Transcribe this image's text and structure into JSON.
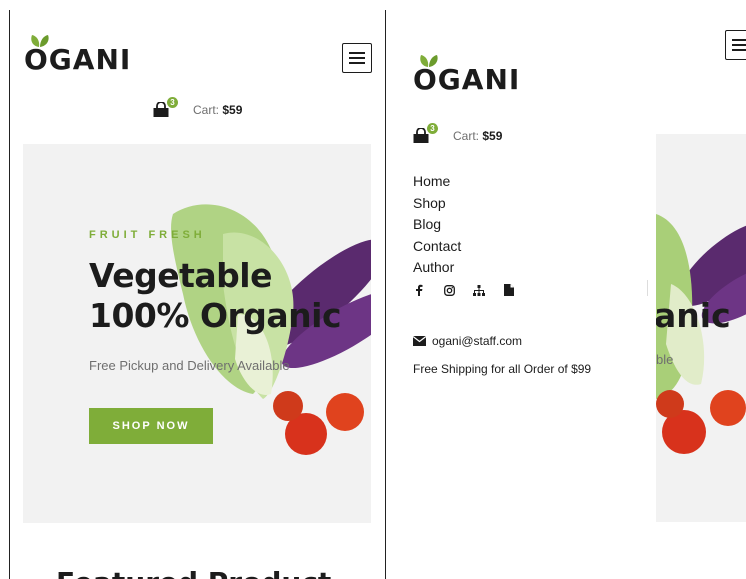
{
  "brand": {
    "name": "OGANI"
  },
  "cart": {
    "count": "3",
    "label": "Cart:",
    "total": "$59"
  },
  "hero": {
    "tag": "FRUIT FRESH",
    "title_line1": "Vegetable",
    "title_line2": "100% Organic",
    "subtitle": "Free Pickup and Delivery Available",
    "button": "SHOP NOW"
  },
  "section_cut": "Featured Product",
  "menu": {
    "items": [
      "Home",
      "Shop",
      "Blog",
      "Contact",
      "Author"
    ],
    "social": [
      "facebook-icon",
      "instagram-icon",
      "sitemap-icon",
      "file-icon"
    ],
    "email": "ogani@staff.com",
    "shipping": "Free Shipping for all Order of $99"
  },
  "overlay_fragments": {
    "title": "anic",
    "subtitle": "ble"
  },
  "colors": {
    "accent": "#7fad39",
    "hero_bg": "#f2f2f2",
    "text": "#1c1c1c"
  }
}
